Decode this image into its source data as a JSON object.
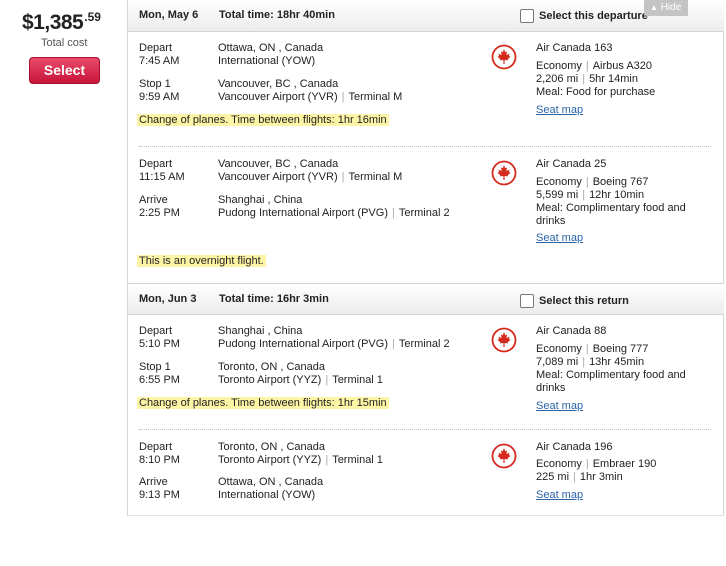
{
  "price": {
    "main": "$1,385",
    "cents": ".59",
    "caption": "Total cost",
    "select_label": "Select"
  },
  "hide_label": "Hide",
  "legs": [
    {
      "date": "Mon, May 6",
      "total": "Total time: 18hr 40min",
      "select_label": "Select this departure",
      "segments": [
        {
          "from": {
            "label": "Depart",
            "time": "7:45 AM",
            "city": "Ottawa, ON , Canada",
            "airport": "International (YOW)",
            "terminal": ""
          },
          "to": {
            "label": "Stop 1",
            "time": "9:59 AM",
            "city": "Vancouver, BC , Canada",
            "airport": "Vancouver Airport (YVR)",
            "terminal": "Terminal M"
          },
          "flight": "Air Canada 163",
          "cabin": "Economy",
          "aircraft": "Airbus A320",
          "distance": "2,206 mi",
          "duration": "5hr 14min",
          "meal": "Meal: Food for purchase",
          "meal2": "",
          "seat_map": "Seat map",
          "note": "Change of planes. Time between flights: 1hr 16min"
        },
        {
          "from": {
            "label": "Depart",
            "time": "11:15 AM",
            "city": "Vancouver, BC , Canada",
            "airport": "Vancouver Airport (YVR)",
            "terminal": "Terminal M"
          },
          "to": {
            "label": "Arrive",
            "time": "2:25 PM",
            "city": "Shanghai , China",
            "airport": "Pudong International Airport (PVG)",
            "terminal": "Terminal 2"
          },
          "flight": "Air Canada 25",
          "cabin": "Economy",
          "aircraft": "Boeing 767",
          "distance": "5,599 mi",
          "duration": "12hr 10min",
          "meal": "Meal: Complimentary food and",
          "meal2": "drinks",
          "seat_map": "Seat map",
          "note": "This is an overnight flight."
        }
      ]
    },
    {
      "date": "Mon, Jun 3",
      "total": "Total time: 16hr 3min",
      "select_label": "Select this return",
      "segments": [
        {
          "from": {
            "label": "Depart",
            "time": "5:10 PM",
            "city": "Shanghai , China",
            "airport": "Pudong International Airport (PVG)",
            "terminal": "Terminal 2"
          },
          "to": {
            "label": "Stop 1",
            "time": "6:55 PM",
            "city": "Toronto, ON , Canada",
            "airport": "Toronto Airport (YYZ)",
            "terminal": "Terminal 1"
          },
          "flight": "Air Canada 88",
          "cabin": "Economy",
          "aircraft": "Boeing 777",
          "distance": "7,089 mi",
          "duration": "13hr 45min",
          "meal": "Meal: Complimentary food and",
          "meal2": "drinks",
          "seat_map": "Seat map",
          "note": "Change of planes. Time between flights: 1hr 15min"
        },
        {
          "from": {
            "label": "Depart",
            "time": "8:10 PM",
            "city": "Toronto, ON , Canada",
            "airport": "Toronto Airport (YYZ)",
            "terminal": "Terminal 1"
          },
          "to": {
            "label": "Arrive",
            "time": "9:13 PM",
            "city": "Ottawa, ON , Canada",
            "airport": "International (YOW)",
            "terminal": ""
          },
          "flight": "Air Canada 196",
          "cabin": "Economy",
          "aircraft": "Embraer 190",
          "distance": "225 mi",
          "duration": "1hr 3min",
          "meal": "",
          "meal2": "",
          "seat_map": "Seat map",
          "note": ""
        }
      ]
    }
  ],
  "colors": {
    "select_button": "#d41f44",
    "airline_red": "#d52b1e",
    "note_highlight": "#fdf5a6",
    "link": "#2a63a8"
  },
  "icons": {
    "airline_logo": "air-canada-maple-leaf-icon",
    "hide_arrow": "triangle-up-icon"
  }
}
